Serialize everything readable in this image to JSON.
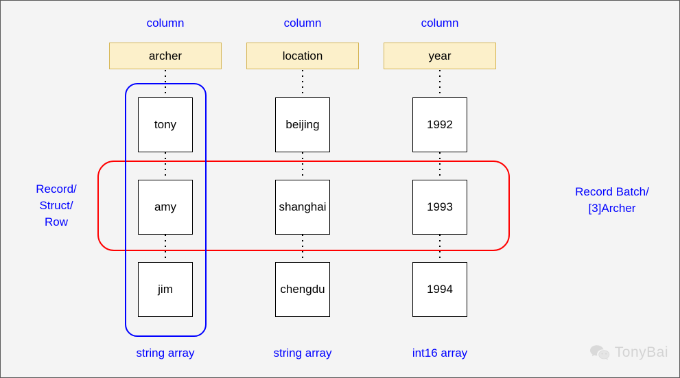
{
  "diagram": {
    "background_color": "#f4f4f4",
    "accent_blue": "#0000ff",
    "accent_red": "#ff0000",
    "header_fill": "#fcf0ca",
    "header_stroke": "#d6b656",
    "columns": [
      {
        "caption": "column",
        "field": "archer",
        "array_type": "string array",
        "cells": [
          "tony",
          "amy",
          "jim"
        ]
      },
      {
        "caption": "column",
        "field": "location",
        "array_type": "string array",
        "cells": [
          "beijing",
          "shanghai",
          "chengdu"
        ]
      },
      {
        "caption": "column",
        "field": "year",
        "array_type": "int16 array",
        "cells": [
          "1992",
          "1993",
          "1994"
        ]
      }
    ],
    "annotations": {
      "record_label_line1": "Record/",
      "record_label_line2": "Struct/",
      "record_label_line3": "Row",
      "batch_label_line1": "Record Batch/",
      "batch_label_line2": "[3]Archer"
    },
    "watermark": {
      "icon": "wechat-icon",
      "text": "TonyBai"
    }
  }
}
